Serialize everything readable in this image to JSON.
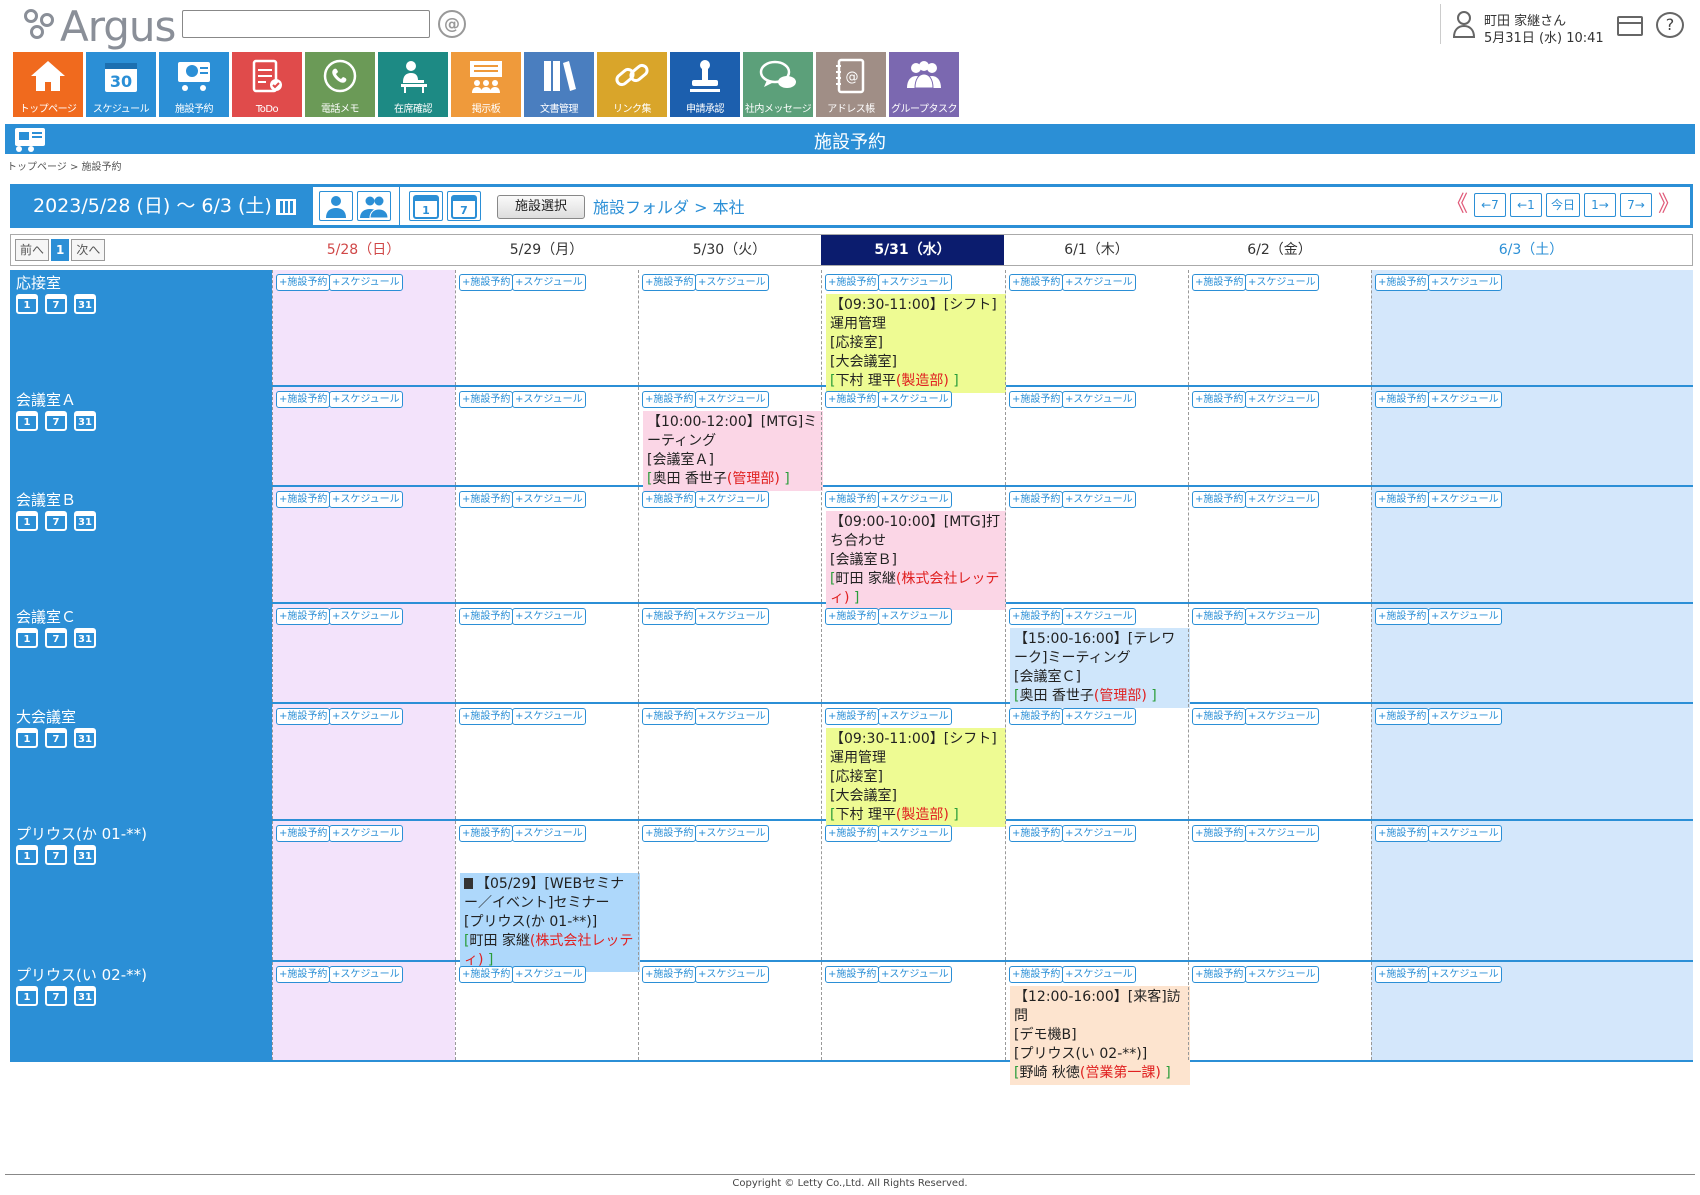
{
  "app": {
    "logo_text": "Argus",
    "search_placeholder": ""
  },
  "user": {
    "name": "町田 家継さん",
    "datetime": "5月31日 (水) 10:41"
  },
  "menu": [
    {
      "label": "トップページ",
      "color": "#f06a1e",
      "icon": "home-icon"
    },
    {
      "label": "スケジュール",
      "color": "#2b8fd6",
      "icon": "calendar-icon",
      "icon_text": "30"
    },
    {
      "label": "施設予約",
      "color": "#2b8fd6",
      "icon": "facility-icon"
    },
    {
      "label": "ToDo",
      "color": "#e04b4b",
      "icon": "todo-icon"
    },
    {
      "label": "電話メモ",
      "color": "#6b9a57",
      "icon": "phone-icon"
    },
    {
      "label": "在席確認",
      "color": "#1d8a84",
      "icon": "presence-icon"
    },
    {
      "label": "掲示板",
      "color": "#ef9a3b",
      "icon": "board-icon"
    },
    {
      "label": "文書管理",
      "color": "#4a7ebf",
      "icon": "document-icon"
    },
    {
      "label": "リンク集",
      "color": "#d9a52a",
      "icon": "link-icon"
    },
    {
      "label": "申請承認",
      "color": "#1c5fae",
      "icon": "stamp-icon"
    },
    {
      "label": "社内メッセージ",
      "color": "#5ca07a",
      "icon": "message-icon"
    },
    {
      "label": "アドレス帳",
      "color": "#a08e86",
      "icon": "address-book-icon"
    },
    {
      "label": "グループタスク",
      "color": "#7b68b0",
      "icon": "group-task-icon"
    }
  ],
  "page": {
    "title": "施設予約",
    "breadcrumb": "トップページ > 施設予約"
  },
  "nav": {
    "range": "2023/5/28 (日) ～ 6/3 (土)",
    "facility_select": "施設選択",
    "folder": "施設フォルダ > 本社",
    "view_day": "1",
    "view_week": "7",
    "pager": [
      "←7",
      "←1",
      "今日",
      "1→",
      "7→"
    ]
  },
  "header": {
    "prev": "前へ",
    "page": "1",
    "next": "次へ",
    "days": [
      {
        "label": "5/28（日）",
        "type": "sun"
      },
      {
        "label": "5/29（月）",
        "type": ""
      },
      {
        "label": "5/30（火）",
        "type": ""
      },
      {
        "label": "5/31（水）",
        "type": "today"
      },
      {
        "label": "6/1（木）",
        "type": ""
      },
      {
        "label": "6/2（金）",
        "type": ""
      },
      {
        "label": "6/3（土）",
        "type": "sat"
      }
    ]
  },
  "buttons": {
    "reserve": "+施設予約",
    "schedule": "+スケジュール"
  },
  "mini_icons": [
    "1",
    "7",
    "31"
  ],
  "rows": [
    {
      "name": "応接室",
      "events": [
        {
          "day": 3,
          "color": "y",
          "time": "【09:30-11:00】",
          "title": "[シフト]運用管理",
          "places": [
            "[応接室]",
            "[大会議室]"
          ],
          "person": "下村 理平",
          "dept": "(製造部)"
        }
      ]
    },
    {
      "name": "会議室Ａ",
      "events": [
        {
          "day": 2,
          "color": "p",
          "time": "【10:00-12:00】",
          "title": "[MTG]ミーティング",
          "places": [
            "[会議室Ａ]"
          ],
          "person": "奥田 香世子",
          "dept": "(管理部)"
        }
      ]
    },
    {
      "name": "会議室Ｂ",
      "events": [
        {
          "day": 3,
          "color": "p",
          "time": "【09:00-10:00】",
          "title": "[MTG]打ち合わせ",
          "places": [
            "[会議室Ｂ]"
          ],
          "person": "町田 家継",
          "dept": "(株式会社レッティ)"
        }
      ]
    },
    {
      "name": "会議室Ｃ",
      "events": [
        {
          "day": 4,
          "color": "b",
          "time": "【15:00-16:00】",
          "title": "[テレワーク]ミーティング",
          "places": [
            "[会議室Ｃ]"
          ],
          "person": "奥田 香世子",
          "dept": "(管理部)"
        }
      ]
    },
    {
      "name": "大会議室",
      "events": [
        {
          "day": 3,
          "color": "y",
          "time": "【09:30-11:00】",
          "title": "[シフト]運用管理",
          "places": [
            "[応接室]",
            "[大会議室]"
          ],
          "person": "下村 理平",
          "dept": "(製造部)"
        }
      ]
    },
    {
      "name": "プリウス(か 01-**)",
      "events": [
        {
          "day": 1,
          "color": "bb",
          "time": "【05/29】",
          "title": "[WEBセミナー／イベント]セミナー",
          "places": [
            "[プリウス(か 01-**)]"
          ],
          "person": "町田 家継",
          "dept": "(株式会社レッティ)"
        }
      ]
    },
    {
      "name": "プリウス(い 02-**)",
      "events": [
        {
          "day": 4,
          "color": "o",
          "time": "【12:00-16:00】",
          "title": "[来客]訪問",
          "places": [
            "[デモ機B]",
            "[プリウス(い 02-**)]"
          ],
          "person": "野崎 秋徳",
          "dept": "(営業第一課)"
        }
      ]
    }
  ],
  "footer": {
    "copyright": "Copyright © Letty Co.,Ltd. All Rights Reserved."
  }
}
